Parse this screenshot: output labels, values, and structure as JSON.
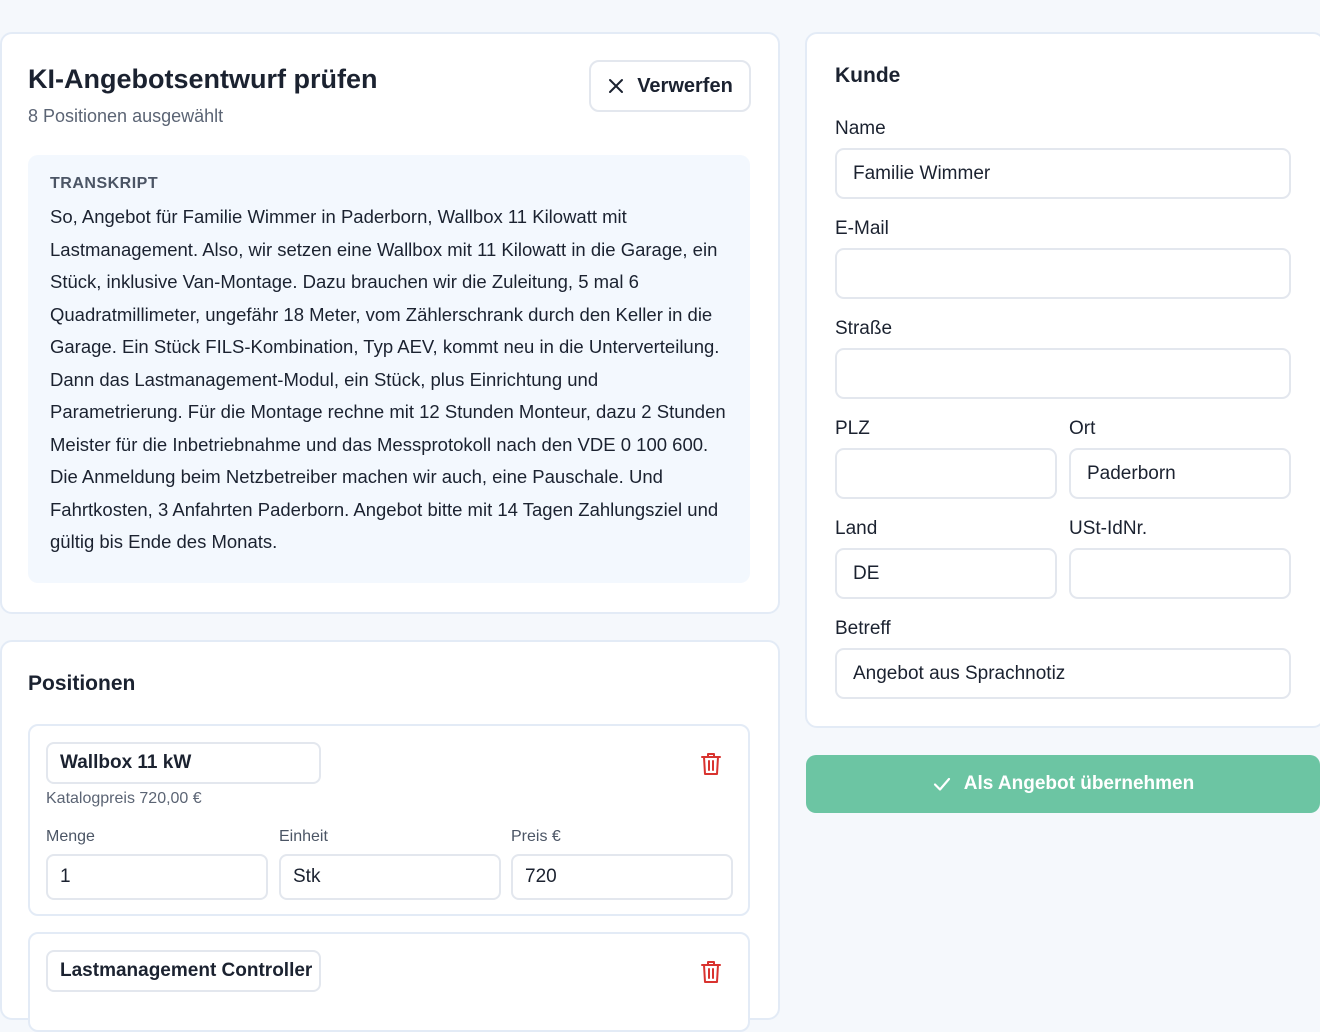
{
  "review": {
    "title": "KI-Angebotsentwurf prüfen",
    "subtitle": "8 Positionen ausgewählt",
    "discard_label": "Verwerfen",
    "transcript_label": "TRANSKRIPT",
    "transcript_text": "So, Angebot für Familie Wimmer in Paderborn, Wallbox 11 Kilowatt mit Lastmanagement. Also, wir setzen eine Wallbox mit 11 Kilowatt in die Garage, ein Stück, inklusive Van-Montage. Dazu brauchen wir die Zuleitung, 5 mal 6 Quadratmillimeter, ungefähr 18 Meter, vom Zählerschrank durch den Keller in die Garage. Ein Stück FILS-Kombination, Typ AEV, kommt neu in die Unterverteilung. Dann das Lastmanagement-Modul, ein Stück, plus Einrichtung und Parametrierung. Für die Montage rechne mit 12 Stunden Monteur, dazu 2 Stunden Meister für die Inbetriebnahme und das Messprotokoll nach den VDE 0 100 600. Die Anmeldung beim Netzbetreiber machen wir auch, eine Pauschale. Und Fahrtkosten, 3 Anfahrten Paderborn. Angebot bitte mit 14 Tagen Zahlungsziel und gültig bis Ende des Monats."
  },
  "positions": {
    "title": "Positionen",
    "labels": {
      "quantity": "Menge",
      "unit": "Einheit",
      "price": "Preis €"
    },
    "items": [
      {
        "name": "Wallbox 11 kW",
        "catalog": "Katalogpreis 720,00 €",
        "quantity": "1",
        "unit": "Stk",
        "price": "720"
      },
      {
        "name": "Lastmanagement Controller"
      }
    ]
  },
  "customer": {
    "title": "Kunde",
    "name_label": "Name",
    "name_value": "Familie Wimmer",
    "email_label": "E-Mail",
    "email_value": "",
    "street_label": "Straße",
    "street_value": "",
    "zip_label": "PLZ",
    "zip_value": "",
    "city_label": "Ort",
    "city_value": "Paderborn",
    "country_label": "Land",
    "country_value": "DE",
    "vat_label": "USt-IdNr.",
    "vat_value": "",
    "subject_label": "Betreff",
    "subject_value": "Angebot aus Sprachnotiz"
  },
  "actions": {
    "accept_label": "Als Angebot übernehmen"
  },
  "colors": {
    "accent": "#6cc5a3",
    "danger": "#d9332f",
    "border": "#e3ebf6"
  },
  "icons": {
    "discard": "close-icon",
    "delete": "trash-icon",
    "accept": "check-icon"
  }
}
